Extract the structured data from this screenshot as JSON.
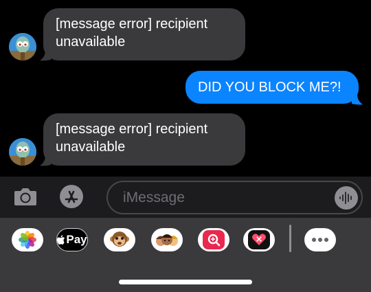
{
  "thread": {
    "messages": [
      {
        "direction": "in",
        "text": "[message error] recipient unavailable"
      },
      {
        "direction": "out",
        "text": "DID YOU BLOCK ME?!"
      },
      {
        "direction": "in",
        "text": "[message error] recipient unavailable"
      }
    ]
  },
  "composer": {
    "placeholder": "iMessage",
    "icons": [
      "camera-icon",
      "app-store-icon",
      "waveform-icon"
    ]
  },
  "app_drawer": {
    "apps": [
      "photos",
      "apple-pay",
      "animoji",
      "memoji",
      "image-search",
      "digital-touch",
      "more"
    ],
    "apple_pay_label": "Pay"
  },
  "colors": {
    "incoming_bubble": "#3a3a3c",
    "outgoing_bubble": "#0a84ff",
    "background": "#000000"
  }
}
